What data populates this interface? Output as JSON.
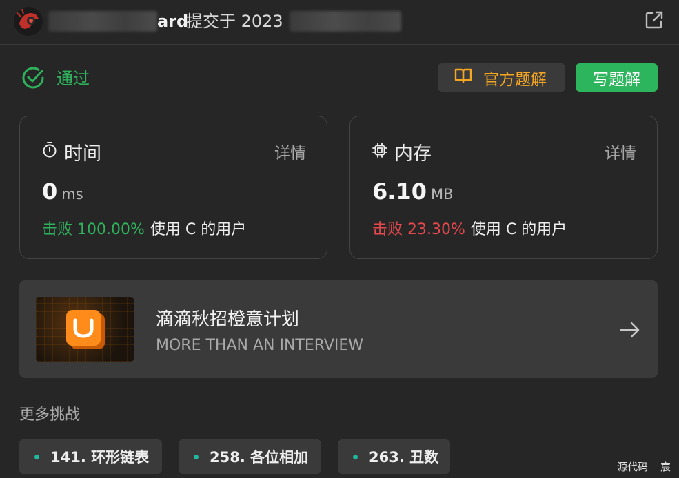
{
  "header": {
    "username_visible": "ard",
    "submit_text": "提交于 2023",
    "external_icon": "external-link-icon"
  },
  "status": {
    "label": "通过",
    "icon": "check-circle-icon",
    "color": "#2fb25c"
  },
  "actions": {
    "official_solution_label": "官方题解",
    "official_solution_icon": "book-icon",
    "write_solution_label": "写题解",
    "accent": "#f5a623",
    "primary": "#2db55d"
  },
  "time_card": {
    "title": "时间",
    "icon": "stopwatch-icon",
    "detail_label": "详情",
    "value": "0",
    "unit": "ms",
    "beat_prefix": "击败 100.00%",
    "beat_suffix": "使用 C 的用户"
  },
  "memory_card": {
    "title": "内存",
    "icon": "chip-icon",
    "detail_label": "详情",
    "value": "6.10",
    "unit": "MB",
    "beat_prefix": "击败 23.30%",
    "beat_suffix": "使用 C 的用户"
  },
  "banner": {
    "title": "滴滴秋招橙意计划",
    "subtitle": "MORE THAN AN INTERVIEW",
    "logo": "didi-logo",
    "arrow_icon": "arrow-right-icon"
  },
  "more": {
    "title": "更多挑战",
    "items": [
      {
        "label": "141. 环形链表"
      },
      {
        "label": "258. 各位相加"
      },
      {
        "label": "263. 丑数"
      }
    ]
  },
  "footer": {
    "source_code": "源代码",
    "trailing": "宸"
  }
}
